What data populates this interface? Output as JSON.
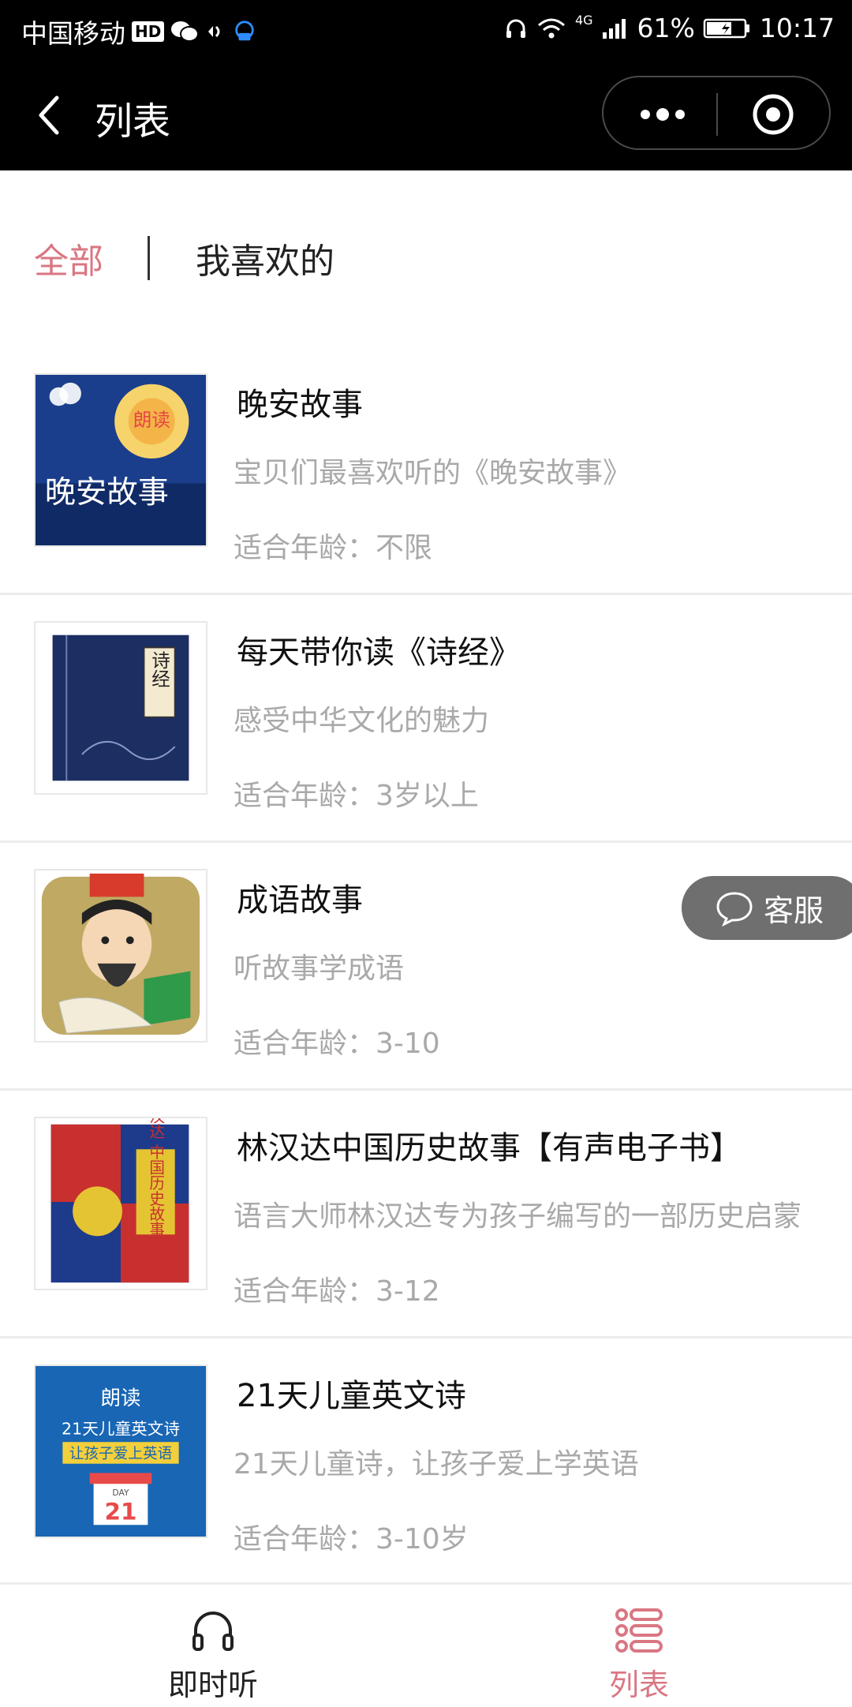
{
  "status_bar": {
    "carrier": "中国移动",
    "hd_badge": "HD",
    "network": "4G",
    "battery": "61%",
    "time": "10:17"
  },
  "nav": {
    "title": "列表"
  },
  "tabs": {
    "all": "全部",
    "liked": "我喜欢的"
  },
  "items": [
    {
      "title": "晚安故事",
      "desc": "宝贝们最喜欢听的《晚安故事》",
      "age": "适合年龄：不限",
      "cover_text": "晚安故事",
      "cover_brand": "朗读"
    },
    {
      "title": "每天带你读《诗经》",
      "desc": "感受中华文化的魅力",
      "age": "适合年龄：3岁以上",
      "cover_text": "诗经"
    },
    {
      "title": "成语故事",
      "desc": "听故事学成语",
      "age": "适合年龄：3-10"
    },
    {
      "title": "林汉达中国历史故事【有声电子书】",
      "desc": "语言大师林汉达专为孩子编写的一部历史启蒙",
      "age": "适合年龄：3-12",
      "cover_text": "林汉达 中国历史故事集"
    },
    {
      "title": "21天儿童英文诗",
      "desc": "21天儿童诗，让孩子爱上学英语",
      "age": "适合年龄：3-10岁",
      "cover_brand": "朗读",
      "cover_line1": "21天儿童英文诗",
      "cover_line2": "让孩子爱上英语",
      "cover_day": "DAY",
      "cover_num": "21"
    }
  ],
  "service": {
    "label": "客服"
  },
  "tabbar": {
    "listen_now": "即时听",
    "list": "列表"
  },
  "colors": {
    "accent": "#d97783",
    "bar_bg": "#000000",
    "muted_text": "#a9a9a9"
  }
}
